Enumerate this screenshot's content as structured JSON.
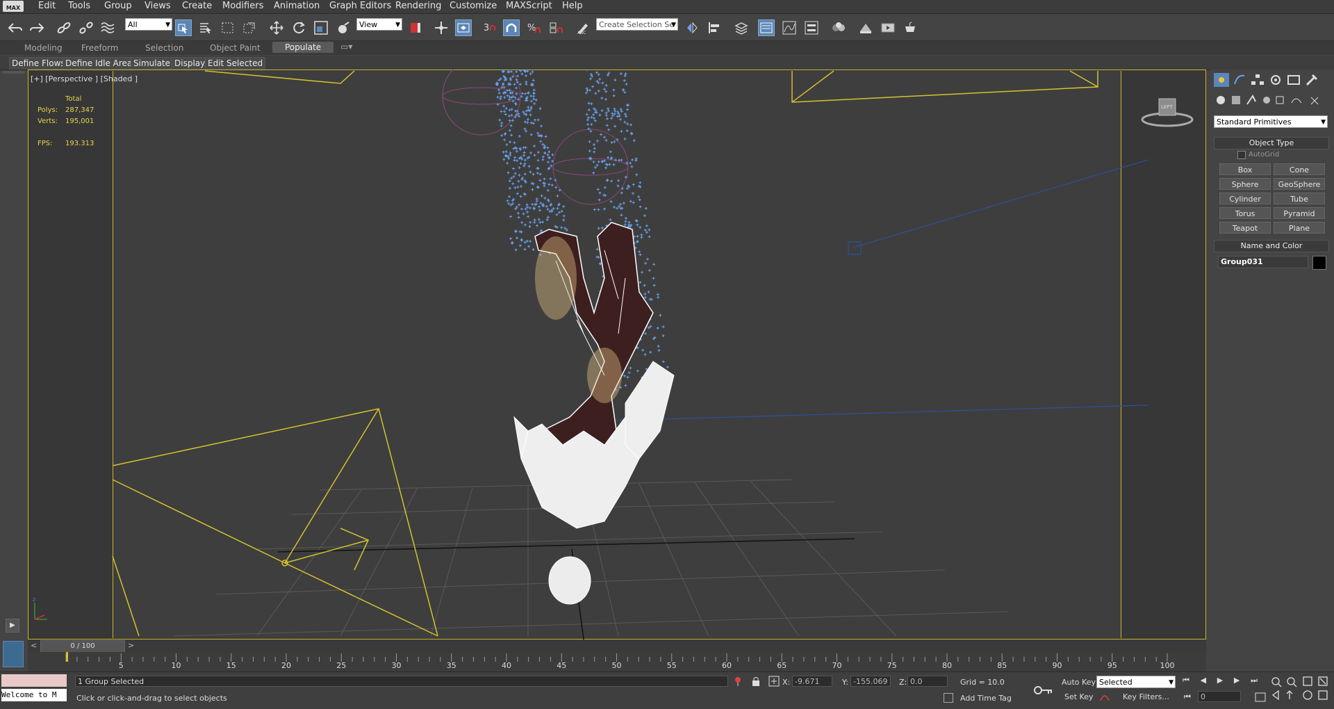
{
  "app": {
    "logo": "MAX"
  },
  "menu": [
    "Edit",
    "Tools",
    "Group",
    "Views",
    "Create",
    "Modifiers",
    "Animation",
    "Graph Editors",
    "Rendering",
    "Customize",
    "MAXScript",
    "Help"
  ],
  "toolbar": {
    "filter_value": "All",
    "refcoord_value": "View",
    "snap_label": "3",
    "named_selection_placeholder": "Create Selection Se",
    "icons": [
      "undo-icon",
      "redo-icon",
      "link-icon",
      "unlink-icon",
      "bind-spacewarp-icon",
      "select-object-icon",
      "select-by-name-icon",
      "rect-region-icon",
      "window-crossing-icon",
      "move-icon",
      "rotate-icon",
      "scale-icon",
      "place-icon",
      "mirror-icon",
      "align-icon",
      "layer-icon",
      "scene-explorer-icon",
      "curve-editor-icon",
      "schematic-icon",
      "material-editor-icon",
      "render-setup-icon",
      "render-frame-icon",
      "render-icon"
    ]
  },
  "ribbon": {
    "tabs": [
      "Modeling",
      "Freeform",
      "Selection",
      "Object Paint",
      "Populate"
    ],
    "active": "Populate",
    "buttons": [
      "Define Flows",
      "Define Idle Areas",
      "Simulate",
      "Display",
      "Edit Selected"
    ]
  },
  "viewport": {
    "label": "[+] [Perspective ] [Shaded ]",
    "stats": {
      "header": "Total",
      "polys_label": "Polys:",
      "polys": "287,347",
      "verts_label": "Verts:",
      "verts": "195,001",
      "fps_label": "FPS:",
      "fps": "193.313"
    },
    "viewcube_label": "LEFT"
  },
  "command_panel": {
    "category": "Standard Primitives",
    "object_type_title": "Object Type",
    "autogrid": "AutoGrid",
    "buttons": [
      "Box",
      "Cone",
      "Sphere",
      "GeoSphere",
      "Cylinder",
      "Tube",
      "Torus",
      "Pyramid",
      "Teapot",
      "Plane"
    ],
    "name_color_title": "Name and Color",
    "object_name": "Group031",
    "object_color": "#000000"
  },
  "timeline": {
    "frame_display": "0 / 100",
    "ticks": [
      "5",
      "10",
      "15",
      "20",
      "25",
      "30",
      "35",
      "40",
      "45",
      "50",
      "55",
      "60",
      "65",
      "70",
      "75",
      "80",
      "85",
      "90",
      "95",
      "100"
    ]
  },
  "status": {
    "selection": "1 Group Selected",
    "prompt": "Click or click-and-drag to select objects",
    "listener": "Welcome to M",
    "x_label": "X:",
    "x": "-9.671",
    "y_label": "Y:",
    "y": "-155.069",
    "z_label": "Z:",
    "z": "0.0",
    "grid": "Grid = 10.0",
    "add_time_tag": "Add Time Tag",
    "auto_key": "Auto Key",
    "set_key": "Set Key",
    "key_mode": "Selected",
    "key_filters": "Key Filters...",
    "current_frame": "0"
  },
  "colors": {
    "accent": "#5b86b9",
    "viewport_border": "#c9b52a",
    "particles": "#6aa3f0"
  }
}
